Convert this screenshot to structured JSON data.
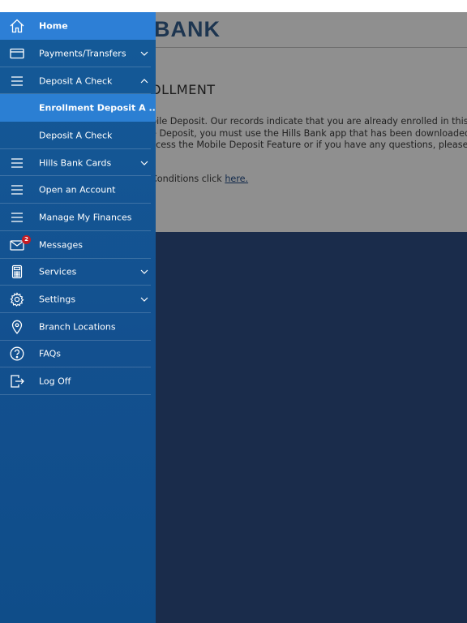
{
  "app": {
    "logo_text": "BANK"
  },
  "page": {
    "heading": "OLLMENT",
    "paragraph_lines": [
      "bile Deposit. Our records indicate that you are already enrolled in this",
      "e Deposit, you must use the Hills Bank app that has been downloaded t",
      "ccess the Mobile Deposit Feature or if you have any questions, please"
    ],
    "link_prefix": "Conditions click ",
    "link_text": "here."
  },
  "menu": {
    "items": [
      {
        "label": "Home",
        "icon": "home-icon"
      },
      {
        "label": "Payments/Transfers",
        "icon": "card-icon",
        "chevron": "down"
      },
      {
        "label": "Deposit A Check",
        "icon": "menu-lines-icon",
        "chevron": "up"
      },
      {
        "label": "Enrollment Deposit A ...",
        "submenu": true,
        "selected": true
      },
      {
        "label": "Deposit A Check",
        "submenu": true
      },
      {
        "label": "Hills Bank Cards",
        "icon": "menu-lines-icon",
        "chevron": "down"
      },
      {
        "label": "Open an Account",
        "icon": "menu-lines-icon"
      },
      {
        "label": "Manage My Finances",
        "icon": "menu-lines-icon"
      },
      {
        "label": "Messages",
        "icon": "envelope-icon",
        "badge": "2"
      },
      {
        "label": "Services",
        "icon": "calculator-icon",
        "chevron": "down"
      },
      {
        "label": "Settings",
        "icon": "gear-icon",
        "chevron": "down"
      },
      {
        "label": "Branch Locations",
        "icon": "location-pin-icon"
      },
      {
        "label": "FAQs",
        "icon": "question-icon"
      },
      {
        "label": "Log Off",
        "icon": "logout-icon"
      }
    ]
  },
  "colors": {
    "drawer_bg": "#145a98",
    "highlight": "#2d7fd6",
    "page_dark": "#1a2c4b",
    "page_overlay": "#8f8f8f",
    "badge": "#c41c24"
  }
}
